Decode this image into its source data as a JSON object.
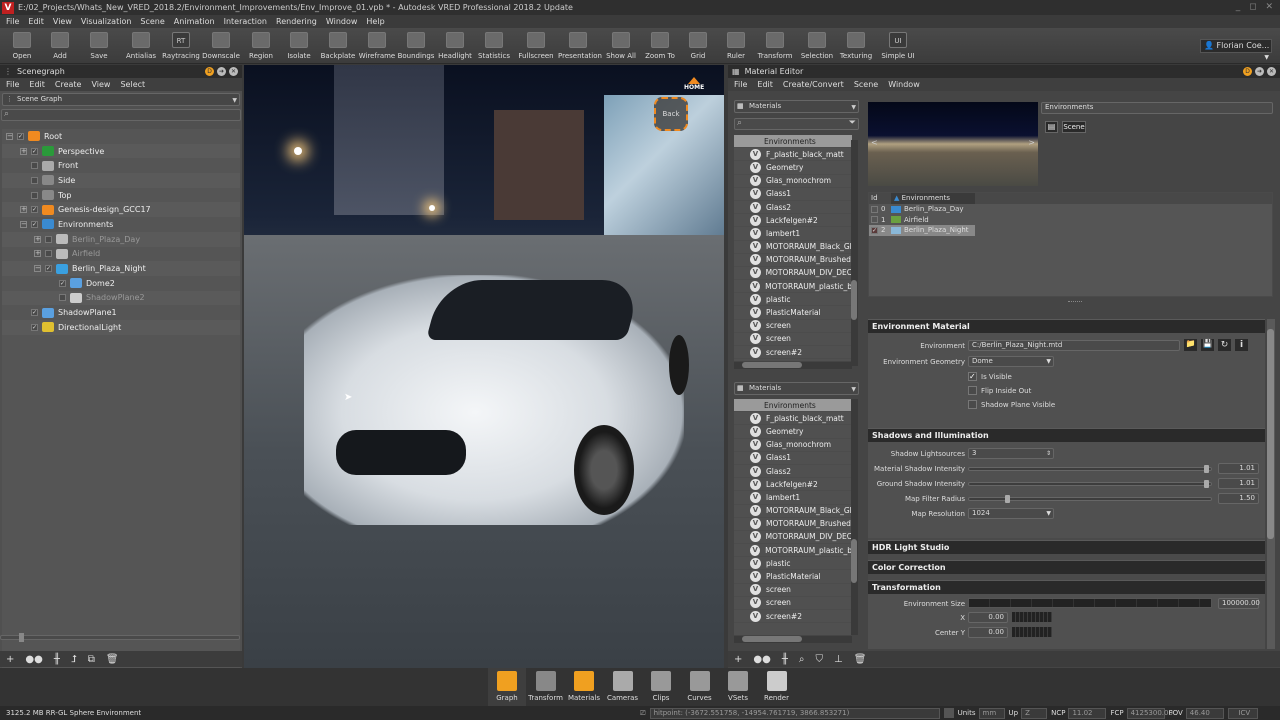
{
  "window": {
    "title": "E:/02_Projects/Whats_New_VRED_2018.2/Environment_Improvements/Env_Improve_01.vpb * - Autodesk VRED Professional 2018.2 Update",
    "logo": "V",
    "controls": "_ ◻ ✕"
  },
  "menu": [
    "File",
    "Edit",
    "View",
    "Visualization",
    "Scene",
    "Animation",
    "Interaction",
    "Rendering",
    "Window",
    "Help"
  ],
  "toolbar": [
    {
      "label": "Open",
      "icon": "folder-icon"
    },
    {
      "label": "Add",
      "icon": "add-file-icon"
    },
    {
      "label": "Save",
      "icon": "save-icon"
    },
    {
      "label": "Antialias",
      "icon": "antialias-icon"
    },
    {
      "label": "Raytracing",
      "icon": "raytracing-icon",
      "glyph": "RT"
    },
    {
      "label": "Downscale",
      "icon": "downscale-icon"
    },
    {
      "label": "Region",
      "icon": "region-icon"
    },
    {
      "label": "Isolate",
      "icon": "isolate-icon"
    },
    {
      "label": "Backplate",
      "icon": "backplate-icon"
    },
    {
      "label": "Wireframe",
      "icon": "wireframe-icon"
    },
    {
      "label": "Boundings",
      "icon": "boundings-icon"
    },
    {
      "label": "Headlight",
      "icon": "headlight-icon"
    },
    {
      "label": "Statistics",
      "icon": "statistics-icon"
    },
    {
      "label": "Fullscreen",
      "icon": "fullscreen-icon"
    },
    {
      "label": "Presentation",
      "icon": "presentation-icon"
    },
    {
      "label": "Show All",
      "icon": "show-all-icon"
    },
    {
      "label": "Zoom To",
      "icon": "zoom-to-icon"
    },
    {
      "label": "Grid",
      "icon": "grid-icon"
    },
    {
      "label": "Ruler",
      "icon": "ruler-icon"
    },
    {
      "label": "Transform",
      "icon": "transform-icon"
    },
    {
      "label": "Selection",
      "icon": "selection-icon"
    },
    {
      "label": "Texturing",
      "icon": "texturing-icon"
    },
    {
      "label": "Simple UI",
      "icon": "simple-ui-icon",
      "glyph": "UI"
    }
  ],
  "user": {
    "name": "Florian Coe..."
  },
  "scenegraph": {
    "title": "Scenegraph",
    "menu": [
      "File",
      "Edit",
      "Create",
      "View",
      "Select"
    ],
    "view_select": "Scene Graph",
    "search_placeholder": "",
    "nodes": [
      {
        "label": "Root",
        "depth": 0,
        "expand": "−",
        "checked": true,
        "color": "#f08a20"
      },
      {
        "label": "Perspective",
        "depth": 1,
        "expand": "+",
        "checked": true,
        "color": "#2a9a3a"
      },
      {
        "label": "Front",
        "depth": 1,
        "expand": "",
        "checked": false,
        "color": "#aaaaaa"
      },
      {
        "label": "Side",
        "depth": 1,
        "expand": "",
        "checked": false,
        "color": "#888888"
      },
      {
        "label": "Top",
        "depth": 1,
        "expand": "",
        "checked": false,
        "color": "#888888"
      },
      {
        "label": "Genesis-design_GCC17",
        "depth": 1,
        "expand": "+",
        "checked": true,
        "color": "#f08a20"
      },
      {
        "label": "Environments",
        "depth": 1,
        "expand": "−",
        "checked": true,
        "color": "#3a8ad0"
      },
      {
        "label": "Berlin_Plaza_Day",
        "depth": 2,
        "expand": "+",
        "checked": false,
        "color": "#bbbbbb",
        "dim": true
      },
      {
        "label": "Airfield",
        "depth": 2,
        "expand": "+",
        "checked": false,
        "color": "#bbbbbb",
        "dim": true
      },
      {
        "label": "Berlin_Plaza_Night",
        "depth": 2,
        "expand": "−",
        "checked": true,
        "color": "#3aa0e0"
      },
      {
        "label": "Dome2",
        "depth": 3,
        "expand": "",
        "checked": true,
        "color": "#5aa0e0"
      },
      {
        "label": "ShadowPlane2",
        "depth": 3,
        "expand": "",
        "checked": false,
        "color": "#cccccc",
        "dim": true
      },
      {
        "label": "ShadowPlane1",
        "depth": 1,
        "expand": "",
        "checked": true,
        "color": "#5aa0e0"
      },
      {
        "label": "DirectionalLight",
        "depth": 1,
        "expand": "",
        "checked": true,
        "color": "#e0c030"
      }
    ],
    "bottom_tools": [
      "add-icon",
      "link-icon",
      "ruler-icon",
      "transform-icon",
      "paste-icon",
      "trash-icon"
    ]
  },
  "viewport": {
    "navcube_label": "Back",
    "home_label": "HOME"
  },
  "material_editor": {
    "title": "Material Editor",
    "menu": [
      "File",
      "Edit",
      "Create/Convert",
      "Scene",
      "Window"
    ],
    "list1": {
      "select": "Materials",
      "header": "Environments",
      "items": [
        "F_plastic_black_matt",
        "Geometry",
        "Glas_monochrom",
        "Glass1",
        "Glass2",
        "Lackfelgen#2",
        "lambert1",
        "MOTORRAUM_Black_Gl",
        "MOTORRAUM_Brushed",
        "MOTORRAUM_DIV_DEC",
        "MOTORRAUM_plastic_b",
        "plastic",
        "PlasticMaterial",
        "screen",
        "screen",
        "screen#2"
      ]
    },
    "list2": {
      "select": "Materials",
      "header": "Environments",
      "items": [
        "F_plastic_black_matt",
        "Geometry",
        "Glas_monochrom",
        "Glass1",
        "Glass2",
        "Lackfelgen#2",
        "lambert1",
        "MOTORRAUM_Black_Gl",
        "MOTORRAUM_Brushed",
        "MOTORRAUM_DIV_DEC",
        "MOTORRAUM_plastic_b",
        "plastic",
        "PlasticMaterial",
        "screen",
        "screen",
        "screen#2"
      ]
    },
    "bottom_tools": [
      "add-icon",
      "link-icon",
      "ruler-icon",
      "find-icon",
      "tag-icon",
      "clean-icon",
      "trash-icon"
    ],
    "preview": {
      "name_field": "Environments",
      "scene_button": "Scene"
    },
    "switch_table": {
      "col_id": "Id",
      "col_name": "Environments",
      "rows": [
        {
          "id": "0",
          "name": "Berlin_Plaza_Day",
          "checked": false
        },
        {
          "id": "1",
          "name": "Airfield",
          "checked": false
        },
        {
          "id": "2",
          "name": "Berlin_Plaza_Night",
          "checked": true
        }
      ]
    },
    "env_material": {
      "title": "Environment Material",
      "environment_label": "Environment",
      "environment_value": "C:/Berlin_Plaza_Night.mtd",
      "geometry_label": "Environment Geometry",
      "geometry_value": "Dome",
      "is_visible": {
        "label": "Is Visible",
        "checked": true
      },
      "flip_inside_out": {
        "label": "Flip Inside Out",
        "checked": false
      },
      "shadow_plane_visible": {
        "label": "Shadow Plane Visible",
        "checked": false
      }
    },
    "shadows": {
      "title": "Shadows and Illumination",
      "lightsources_label": "Shadow Lightsources",
      "lightsources_value": "3",
      "material_shadow_label": "Material Shadow Intensity",
      "material_shadow_value": "1.01",
      "material_shadow_fraction": 0.98,
      "ground_shadow_label": "Ground Shadow Intensity",
      "ground_shadow_value": "1.01",
      "ground_shadow_fraction": 0.98,
      "map_filter_label": "Map Filter Radius",
      "map_filter_value": "1.50",
      "map_filter_fraction": 0.15,
      "map_resolution_label": "Map Resolution",
      "map_resolution_value": "1024"
    },
    "collapsed_sections": [
      "HDR Light Studio",
      "Color Correction"
    ],
    "transformation": {
      "title": "Transformation",
      "env_size_label": "Environment Size",
      "env_size_value": "100000.00",
      "x_label": "X",
      "x_value": "0.00",
      "center_y_label": "Center Y",
      "center_y_value": "0.00"
    }
  },
  "dock": [
    {
      "label": "Graph",
      "icon": "graph-icon"
    },
    {
      "label": "Transform",
      "icon": "transform-icon"
    },
    {
      "label": "Materials",
      "icon": "materials-icon"
    },
    {
      "label": "Cameras",
      "icon": "cameras-icon"
    },
    {
      "label": "Clips",
      "icon": "clips-icon"
    },
    {
      "label": "Curves",
      "icon": "curves-icon"
    },
    {
      "label": "VSets",
      "icon": "vsets-icon"
    },
    {
      "label": "Render",
      "icon": "render-icon"
    }
  ],
  "statusbar": {
    "memory": "3125.2 MB  RR-GL  Sphere Environment",
    "hitpoint": "hitpoint: (-3672.551758, -14954.761719, 3866.853271)",
    "units_label": "Units",
    "units_value": "mm",
    "up_label": "Up",
    "up_value": "Z",
    "ncp_label": "NCP",
    "ncp_value": "11.02",
    "fcp_label": "FCP",
    "fcp_value": "4125300.00",
    "fov_label": "FOV",
    "fov_value": "46.40",
    "mode": "ICV"
  }
}
